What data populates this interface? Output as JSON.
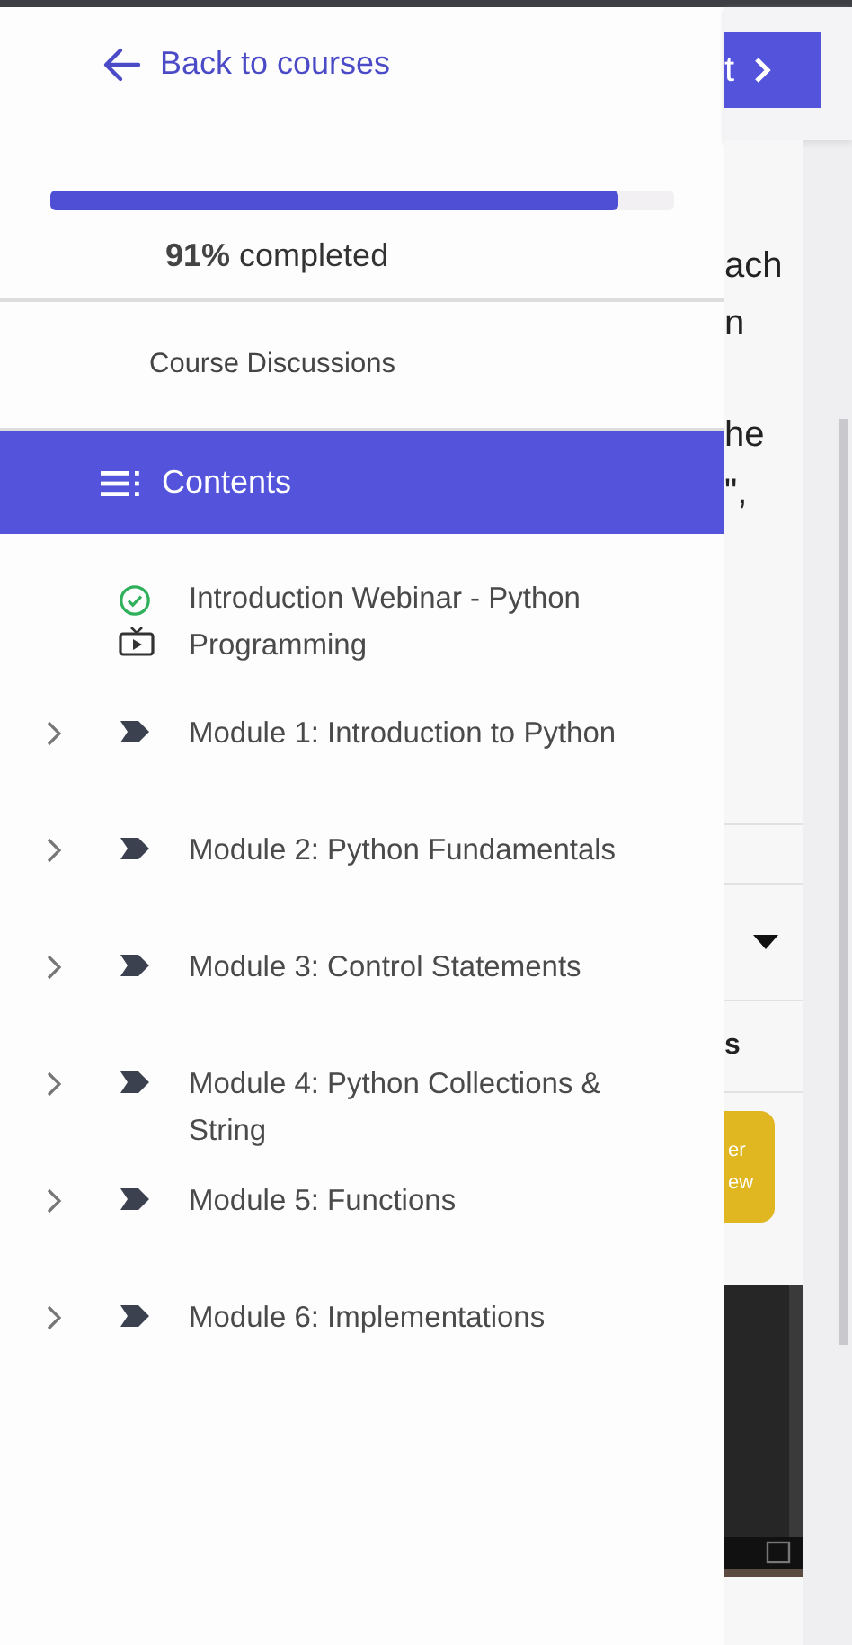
{
  "drawer": {
    "back_link": "Back to courses",
    "progress": {
      "level": 0.91,
      "percent": "91%",
      "label": "completed"
    },
    "discussions_link": "Course Discussions",
    "contents_header": "Contents",
    "items": [
      {
        "kind": "lesson",
        "title": "Introduction Webinar - Python Programming",
        "completed": true
      },
      {
        "kind": "module",
        "title": "Module 1: Introduction to Python",
        "expanded": false
      },
      {
        "kind": "module",
        "title": "Module 2: Python Fundamentals",
        "expanded": false
      },
      {
        "kind": "module",
        "title": "Module 3: Control Statements",
        "expanded": false
      },
      {
        "kind": "module",
        "title": "Module 4: Python Collections & String",
        "expanded": false
      },
      {
        "kind": "module",
        "title": "Module 5: Functions",
        "expanded": false
      },
      {
        "kind": "module",
        "title": "Module 6: Implementations",
        "expanded": false
      }
    ]
  },
  "background_page": {
    "next_button": "t",
    "text_fragments": [
      "ach",
      "n",
      "he",
      "\","
    ],
    "row_text": "s",
    "yellow_button": [
      "er",
      "ew"
    ]
  }
}
